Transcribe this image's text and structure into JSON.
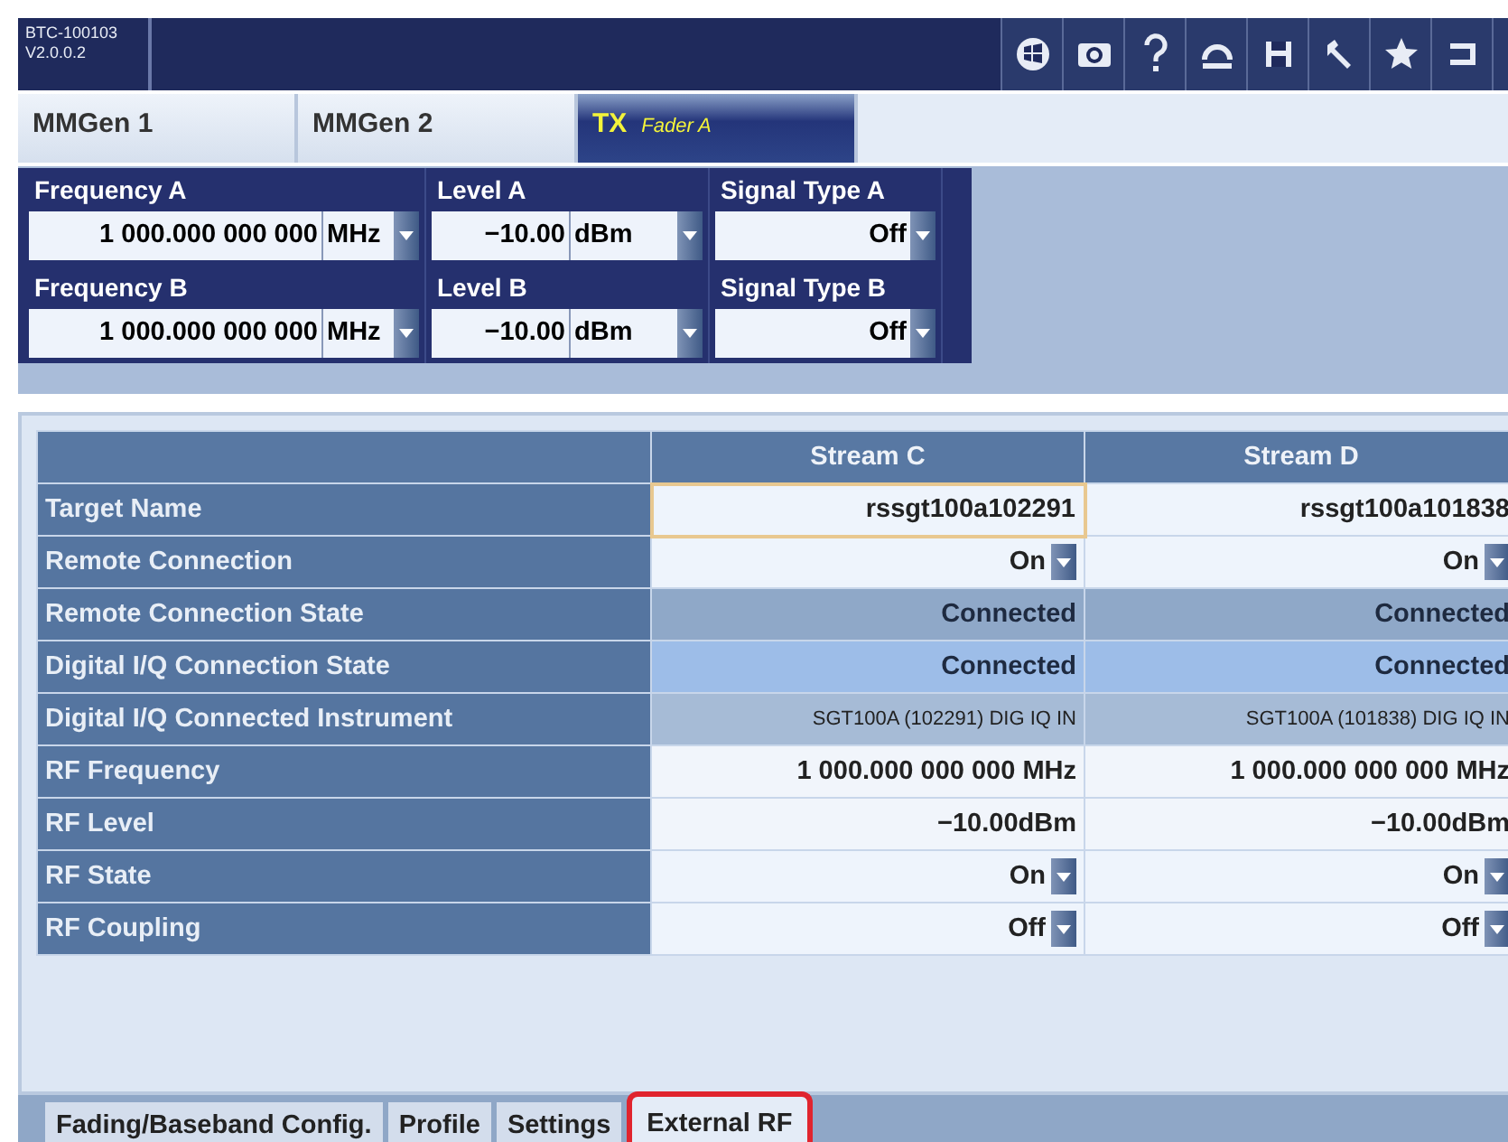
{
  "header": {
    "device": "BTC-100103",
    "version": "V2.0.0.2"
  },
  "tabs": [
    {
      "label": "MMGen 1",
      "selected": false
    },
    {
      "label": "MMGen 2",
      "selected": false
    },
    {
      "label": "TX",
      "sublabel": "Fader A",
      "selected": true
    }
  ],
  "params": [
    [
      {
        "label": "Frequency A",
        "value": "1 000.000 000 000",
        "unit": "MHz"
      },
      {
        "label": "Level A",
        "value": "−10.00",
        "unit": "dBm"
      },
      {
        "label": "Signal Type A",
        "value": "Off"
      }
    ],
    [
      {
        "label": "Frequency B",
        "value": "1 000.000 000 000",
        "unit": "MHz"
      },
      {
        "label": "Level B",
        "value": "−10.00",
        "unit": "dBm"
      },
      {
        "label": "Signal Type B",
        "value": "Off"
      }
    ]
  ],
  "table": {
    "columns": [
      "Stream C",
      "Stream D"
    ],
    "rows": [
      {
        "label": "Target Name",
        "kind": "field",
        "cells": [
          {
            "text": "rssgt100a102291",
            "focused": true
          },
          {
            "text": "rssgt100a101838",
            "focused": false
          }
        ]
      },
      {
        "label": "Remote Connection",
        "kind": "select",
        "cells": [
          {
            "text": "On",
            "focused": false
          },
          {
            "text": "On",
            "focused": false
          }
        ]
      },
      {
        "label": "Remote Connection State",
        "kind": "state",
        "cells": [
          {
            "text": "Connected",
            "focused": false
          },
          {
            "text": "Connected",
            "focused": false
          }
        ]
      },
      {
        "label": "Digital I/Q Connection State",
        "kind": "link",
        "cells": [
          {
            "text": "Connected",
            "focused": false
          },
          {
            "text": "Connected",
            "focused": false
          }
        ]
      },
      {
        "label": "Digital I/Q Connected Instrument",
        "kind": "small",
        "cells": [
          {
            "text": "SGT100A (102291) DIG IQ IN",
            "focused": false
          },
          {
            "text": "SGT100A (101838) DIG IQ IN",
            "focused": false
          }
        ]
      },
      {
        "label": "RF Frequency",
        "kind": "readout",
        "cells": [
          {
            "text": "1 000.000 000 000 MHz",
            "focused": false
          },
          {
            "text": "1 000.000 000 000 MHz",
            "focused": false
          }
        ]
      },
      {
        "label": "RF Level",
        "kind": "readout",
        "cells": [
          {
            "text": "−10.00dBm",
            "focused": false
          },
          {
            "text": "−10.00dBm",
            "focused": false
          }
        ]
      },
      {
        "label": "RF State",
        "kind": "select",
        "cells": [
          {
            "text": "On",
            "focused": false
          },
          {
            "text": "On",
            "focused": false
          }
        ]
      },
      {
        "label": "RF Coupling",
        "kind": "select",
        "cells": [
          {
            "text": "Off",
            "focused": false
          },
          {
            "text": "Off",
            "focused": false
          }
        ]
      }
    ]
  },
  "bottom_tabs": [
    {
      "label": "Fading/Baseband Config.",
      "selected": false
    },
    {
      "label": "Profile",
      "selected": false
    },
    {
      "label": "Settings",
      "selected": false
    },
    {
      "label": "External RF",
      "selected": true
    }
  ]
}
